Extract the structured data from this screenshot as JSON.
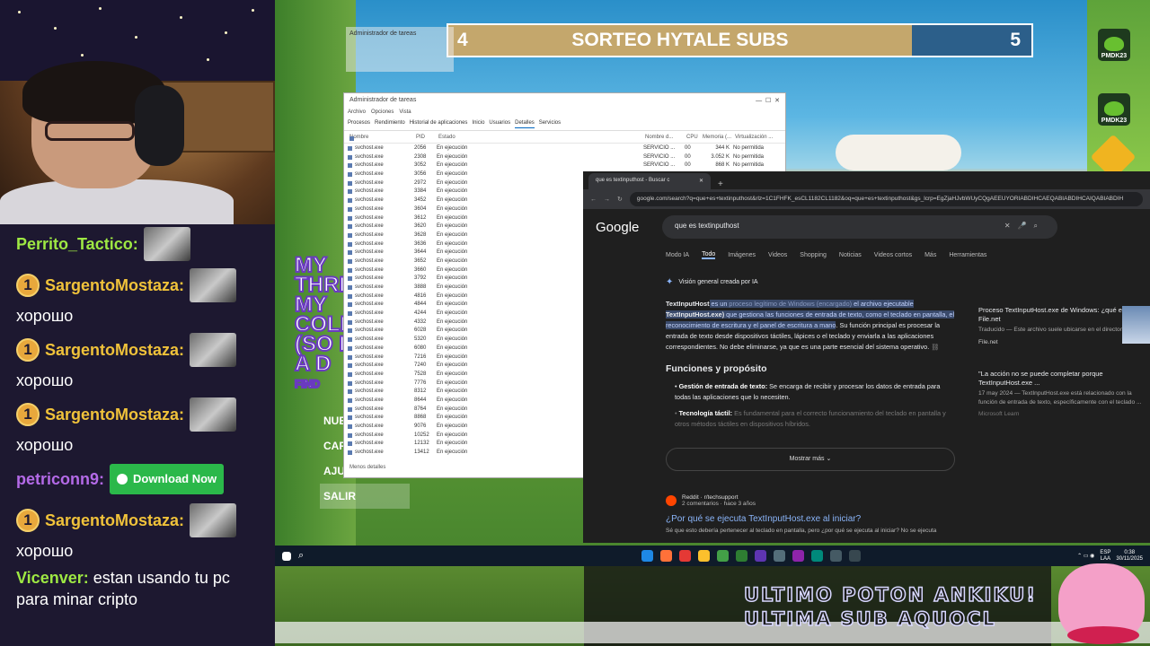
{
  "banner": {
    "left_number": "4",
    "title": "SORTEO HYTALE SUBS",
    "right_number": "5"
  },
  "side_icons": [
    {
      "name": "PMDK23"
    },
    {
      "name": "PMDK23"
    }
  ],
  "chat": [
    {
      "user": "Perrito_Tactico:",
      "color": "#9ee843",
      "badge": "",
      "emote": true,
      "message": ""
    },
    {
      "user": "SargentoMostaza:",
      "color": "#f0c23a",
      "badge": "1",
      "emote": true,
      "message": "хорошо"
    },
    {
      "user": "SargentoMostaza:",
      "color": "#f0c23a",
      "badge": "1",
      "emote": true,
      "message": "хорошо"
    },
    {
      "user": "SargentoMostaza:",
      "color": "#f0c23a",
      "badge": "1",
      "emote": true,
      "message": "хорошо"
    },
    {
      "user": "petriconn9:",
      "color": "#b46ae8",
      "badge": "",
      "button": "Download Now",
      "message": ""
    },
    {
      "user": "SargentoMostaza:",
      "color": "#f0c23a",
      "badge": "1",
      "emote": true,
      "message": "хорошо"
    },
    {
      "user": "Vicenver:",
      "color": "#9ee843",
      "badge": "",
      "message": "estan usando tu pc para minar cripto"
    }
  ],
  "game_menu": [
    "NUE",
    "CAR",
    "AJU",
    "SALIR"
  ],
  "promo_text": [
    "MY",
    "THRI",
    "MY",
    "COLL",
    "(SO I",
    "A D",
    "FIND"
  ],
  "task_manager": {
    "title": "Administrador de tareas",
    "menu": [
      "Archivo",
      "Opciones",
      "Vista"
    ],
    "tabs": [
      "Procesos",
      "Rendimiento",
      "Historial de aplicaciones",
      "Inicio",
      "Usuarios",
      "Detalles",
      "Servicios"
    ],
    "columns": [
      "Nombre",
      "PID",
      "Estado",
      "Nombre d...",
      "CPU",
      "Memoria (...",
      "Virtualización ..."
    ],
    "rows": [
      [
        "svchost.exe",
        "2056",
        "En ejecución",
        "SERVICIO ...",
        "00",
        "344 K",
        "No permitida"
      ],
      [
        "svchost.exe",
        "2308",
        "En ejecución",
        "SERVICIO ...",
        "00",
        "3.052 K",
        "No permitida"
      ],
      [
        "svchost.exe",
        "3052",
        "En ejecución",
        "SERVICIO ...",
        "00",
        "868 K",
        "No permitida"
      ],
      [
        "svchost.exe",
        "3056",
        "En ejecución",
        "",
        "",
        "",
        ""
      ],
      [
        "svchost.exe",
        "2972",
        "En ejecución",
        "",
        "",
        "",
        ""
      ],
      [
        "svchost.exe",
        "3384",
        "En ejecución",
        "",
        "",
        "",
        ""
      ],
      [
        "svchost.exe",
        "3452",
        "En ejecución",
        "",
        "",
        "",
        ""
      ],
      [
        "svchost.exe",
        "3604",
        "En ejecución",
        "",
        "",
        "",
        ""
      ],
      [
        "svchost.exe",
        "3612",
        "En ejecución",
        "",
        "",
        "",
        ""
      ],
      [
        "svchost.exe",
        "3620",
        "En ejecución",
        "",
        "",
        "",
        ""
      ],
      [
        "svchost.exe",
        "3628",
        "En ejecución",
        "",
        "",
        "",
        ""
      ],
      [
        "svchost.exe",
        "3636",
        "En ejecución",
        "",
        "",
        "",
        ""
      ],
      [
        "svchost.exe",
        "3644",
        "En ejecución",
        "",
        "",
        "",
        ""
      ],
      [
        "svchost.exe",
        "3652",
        "En ejecución",
        "",
        "",
        "",
        ""
      ],
      [
        "svchost.exe",
        "3660",
        "En ejecución",
        "",
        "",
        "",
        ""
      ],
      [
        "svchost.exe",
        "3792",
        "En ejecución",
        "",
        "",
        "",
        ""
      ],
      [
        "svchost.exe",
        "3888",
        "En ejecución",
        "",
        "",
        "",
        ""
      ],
      [
        "svchost.exe",
        "4816",
        "En ejecución",
        "",
        "",
        "",
        ""
      ],
      [
        "svchost.exe",
        "4844",
        "En ejecución",
        "",
        "",
        "",
        ""
      ],
      [
        "svchost.exe",
        "4244",
        "En ejecución",
        "",
        "",
        "",
        ""
      ],
      [
        "svchost.exe",
        "4332",
        "En ejecución",
        "",
        "",
        "",
        ""
      ],
      [
        "svchost.exe",
        "6028",
        "En ejecución",
        "",
        "",
        "",
        ""
      ],
      [
        "svchost.exe",
        "5320",
        "En ejecución",
        "",
        "",
        "",
        ""
      ],
      [
        "svchost.exe",
        "6080",
        "En ejecución",
        "",
        "",
        "",
        ""
      ],
      [
        "svchost.exe",
        "7216",
        "En ejecución",
        "",
        "",
        "",
        ""
      ],
      [
        "svchost.exe",
        "7240",
        "En ejecución",
        "",
        "",
        "",
        ""
      ],
      [
        "svchost.exe",
        "7528",
        "En ejecución",
        "",
        "",
        "",
        ""
      ],
      [
        "svchost.exe",
        "7776",
        "En ejecución",
        "",
        "",
        "",
        ""
      ],
      [
        "svchost.exe",
        "8312",
        "En ejecución",
        "",
        "",
        "",
        ""
      ],
      [
        "svchost.exe",
        "8644",
        "En ejecución",
        "",
        "",
        "",
        ""
      ],
      [
        "svchost.exe",
        "8764",
        "En ejecución",
        "",
        "",
        "",
        ""
      ],
      [
        "svchost.exe",
        "8868",
        "En ejecución",
        "",
        "",
        "",
        ""
      ],
      [
        "svchost.exe",
        "9076",
        "En ejecución",
        "",
        "",
        "",
        ""
      ],
      [
        "svchost.exe",
        "10252",
        "En ejecución",
        "",
        "",
        "",
        ""
      ],
      [
        "svchost.exe",
        "12132",
        "En ejecución",
        "",
        "",
        "",
        ""
      ],
      [
        "svchost.exe",
        "13412",
        "En ejecución",
        "",
        "",
        "",
        ""
      ]
    ],
    "footer": "Menos detalles"
  },
  "browser": {
    "tab_title": "que es textinputhost - Buscar c",
    "url": "google.com/search?q=que+es+textinputhost&rlz=1C1FHFK_esCL1182CL1182&oq=que+es+textinputhost&gs_lcrp=EgZjaHJvbWUyCQgAEEUYORIABDIHCAEQABIABDIHCAIQABIABDIH",
    "logo": "Google",
    "query": "que es textinputhost",
    "tabs": [
      "Modo IA",
      "Todo",
      "Imágenes",
      "Videos",
      "Shopping",
      "Noticias",
      "Videos cortos",
      "Más",
      "Herramientas"
    ],
    "ai_overview_title": "Visión general creada por IA",
    "ai_p1": {
      "term": "TextInputHost",
      "a": " es un ",
      "b": "proceso legítimo de Windows (encargado)",
      "c": " el archivo ejecutable ",
      "d": "TextInputHost.exe)",
      "e": " que gestiona las funciones de entrada de texto, como el teclado en pantalla, el reconocimiento de escritura y el panel de escritura a mano",
      "f": ". Su función principal es procesar la entrada de texto desde dispositivos táctiles, lápices o el teclado y enviarla a las aplicaciones correspondientes. No debe eliminarse, ya que es una parte esencial del sistema operativo."
    },
    "section_title": "Funciones y propósito",
    "bullets": [
      {
        "title": "Gestión de entrada de texto:",
        "text": " Se encarga de recibir y procesar los datos de entrada para todas las aplicaciones que lo necesiten."
      },
      {
        "title": "Tecnología táctil:",
        "text": " Es fundamental para el correcto funcionamiento del teclado en pantalla y otros métodos táctiles en dispositivos híbridos."
      }
    ],
    "show_more": "Mostrar más",
    "reddit": {
      "source": "Reddit · r/techsupport",
      "meta": "2 comentarios · hace 3 años",
      "link": "¿Por qué se ejecuta TextInputHost.exe al iniciar?",
      "snippet": "Sé que esto debería pertenecer al teclado en pantalla, pero ¿por qué se ejecuta al iniciar? No se ejecuta"
    },
    "side": [
      {
        "title": "Proceso TextInputHost.exe de Windows: ¿qué es? - File.net",
        "snippet": "Traducido — Este archivo suele ubicarse en el directorio ...",
        "source": "File.net"
      },
      {
        "title": "\"La acción no se puede completar porque TextInputHost.exe ...",
        "snippet": "17 may 2024 — TextInputHost.exe está relacionado con la función de entrada de texto, específicamente con el teclado ...",
        "source": "Microsoft Learn"
      }
    ]
  },
  "taskbar": {
    "lang": "ESP",
    "region": "LAA",
    "time": "0:38",
    "date": "30/11/2025"
  },
  "marquee": {
    "line1": "ULTIMO POTON  ANKIKU!",
    "line2": "ULTIMA SUB  AQUOCL"
  }
}
